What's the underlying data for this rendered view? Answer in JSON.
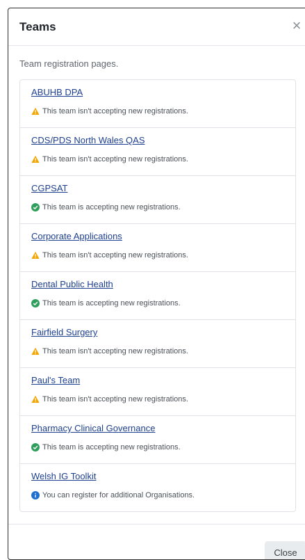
{
  "modal": {
    "title": "Teams",
    "close_glyph": "×",
    "intro": "Team registration pages.",
    "footer_close_label": "Close"
  },
  "colors": {
    "warning": "#f0a500",
    "success": "#2e9e5b",
    "info": "#1f6fd1",
    "link": "#1d3f8f"
  },
  "teams": [
    {
      "name": "ABUHB DPA",
      "status_icon": "warning-icon",
      "status_text": "This team isn't accepting new registrations."
    },
    {
      "name": "CDS/PDS North Wales QAS",
      "status_icon": "warning-icon",
      "status_text": "This team isn't accepting new registrations."
    },
    {
      "name": "CGPSAT",
      "status_icon": "check-circle-icon",
      "status_text": "This team is accepting new registrations."
    },
    {
      "name": "Corporate Applications",
      "status_icon": "warning-icon",
      "status_text": "This team isn't accepting new registrations."
    },
    {
      "name": "Dental Public Health",
      "status_icon": "check-circle-icon",
      "status_text": "This team is accepting new registrations."
    },
    {
      "name": "Fairfield Surgery",
      "status_icon": "warning-icon",
      "status_text": "This team isn't accepting new registrations."
    },
    {
      "name": "Paul's Team",
      "status_icon": "warning-icon",
      "status_text": "This team isn't accepting new registrations."
    },
    {
      "name": "Pharmacy Clinical Governance",
      "status_icon": "check-circle-icon",
      "status_text": "This team is accepting new registrations."
    },
    {
      "name": "Welsh IG Toolkit",
      "status_icon": "info-icon",
      "status_text": "You can register for additional Organisations."
    }
  ]
}
